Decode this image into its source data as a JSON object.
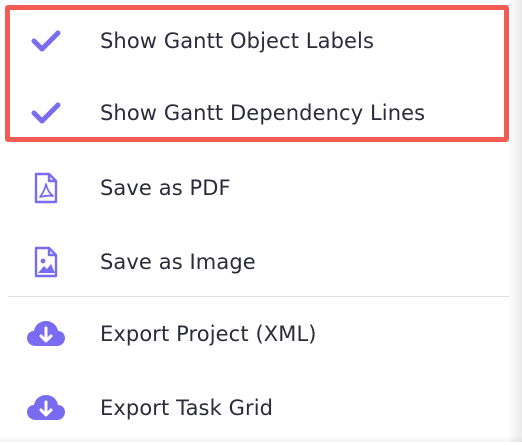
{
  "menu": {
    "items": [
      {
        "label": "Show Gantt Object Labels",
        "icon": "checkmark-icon",
        "checked": true
      },
      {
        "label": "Show Gantt Dependency Lines",
        "icon": "checkmark-icon",
        "checked": true
      },
      {
        "label": "Save as PDF",
        "icon": "pdf-file-icon"
      },
      {
        "label": "Save as Image",
        "icon": "image-file-icon"
      },
      {
        "label": "Export Project (XML)",
        "icon": "cloud-download-icon"
      },
      {
        "label": "Export Task Grid",
        "icon": "cloud-download-icon"
      }
    ]
  },
  "colors": {
    "icon": "#7a6cf0",
    "highlight_border": "#f25c54",
    "text": "#2b2b3a"
  }
}
